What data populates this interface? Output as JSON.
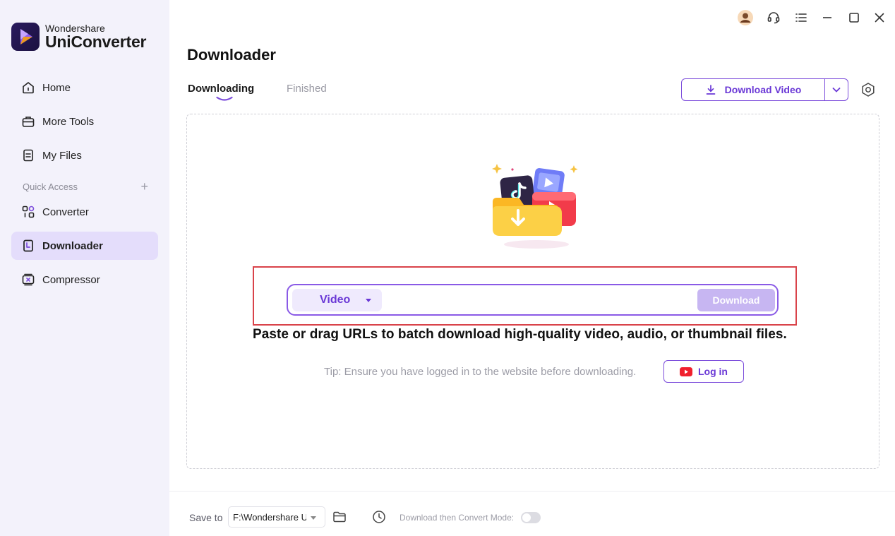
{
  "app": {
    "brand": "Wondershare",
    "product": "UniConverter"
  },
  "sidebar": {
    "items": [
      {
        "label": "Home",
        "icon": "home-icon"
      },
      {
        "label": "More Tools",
        "icon": "toolbox-icon"
      },
      {
        "label": "My Files",
        "icon": "file-icon"
      },
      {
        "label": "Converter",
        "icon": "converter-icon"
      },
      {
        "label": "Downloader",
        "icon": "downloader-icon",
        "active": true
      },
      {
        "label": "Compressor",
        "icon": "compressor-icon"
      }
    ],
    "quick_access_label": "Quick Access",
    "quick_access_add": "+"
  },
  "window_controls": [
    "avatar-icon",
    "headset-icon",
    "menu-icon",
    "minimize-icon",
    "maximize-icon",
    "close-icon"
  ],
  "main": {
    "title": "Downloader",
    "tabs": [
      {
        "label": "Downloading",
        "active": true
      },
      {
        "label": "Finished",
        "active": false
      }
    ],
    "download_video_label": "Download Video",
    "type_select_value": "Video",
    "url_placeholder": "",
    "download_button_label": "Download",
    "headline": "Paste or drag URLs to batch download high-quality video, audio, or thumbnail files.",
    "tip": "Tip: Ensure you have logged in to the website before downloading.",
    "login_label": "Log in"
  },
  "footer": {
    "save_to_label": "Save to",
    "save_path": "F:\\Wondershare UniConverter",
    "convert_mode_label": "Download then Convert Mode:",
    "convert_mode_enabled": false
  },
  "colors": {
    "accent": "#6a38d6",
    "sidebar_bg": "#f3f2fb",
    "active_nav_bg": "#e4ddfb",
    "highlight_red": "#d9434a",
    "download_btn_disabled": "#c7b6f2"
  }
}
